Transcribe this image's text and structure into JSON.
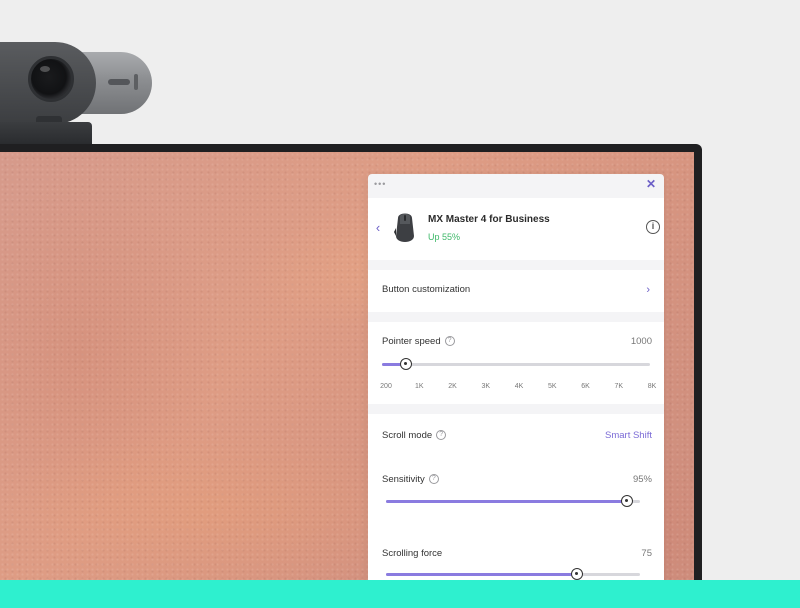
{
  "app": {
    "menu_label": "•••",
    "close_label": "✕"
  },
  "device": {
    "back_label": "‹",
    "name": "MX Master 4 for Business",
    "battery": "Up 55%",
    "info_label": "i"
  },
  "button_customization": {
    "label": "Button customization",
    "chevron": "›"
  },
  "pointer_speed": {
    "label": "Pointer speed",
    "help_label": "?",
    "value": "1000",
    "fraction": 0.09,
    "ticks": [
      "200",
      "1K",
      "2K",
      "3K",
      "4K",
      "5K",
      "6K",
      "7K",
      "8K"
    ]
  },
  "scroll_mode": {
    "label": "Scroll mode",
    "help_label": "?",
    "value": "Smart Shift"
  },
  "sensitivity": {
    "label": "Sensitivity",
    "help_label": "?",
    "value": "95%",
    "fraction": 0.95
  },
  "scrolling_force": {
    "label": "Scrolling force",
    "value": "75",
    "fraction": 0.75
  },
  "colors": {
    "accent": "#8a7be0",
    "link": "#7b6bd6",
    "battery_green": "#3db868",
    "bottom_band": "#2ef0cf"
  },
  "icons": {
    "webcam": "webcam-icon",
    "mouse": "mouse-icon"
  }
}
